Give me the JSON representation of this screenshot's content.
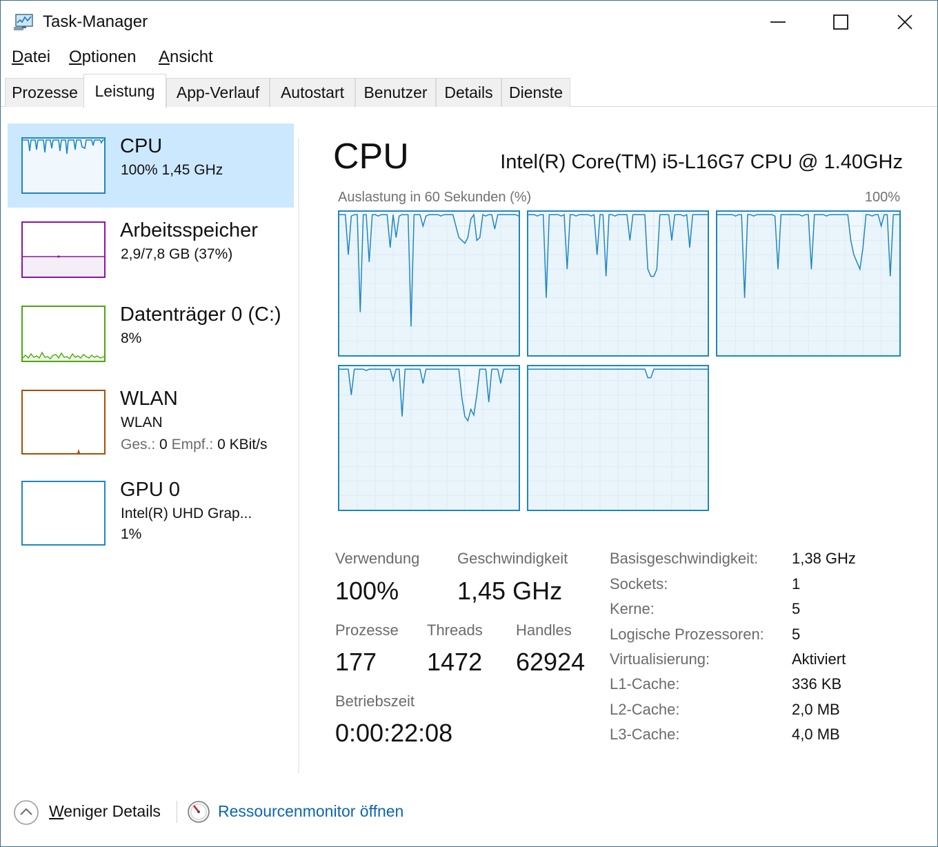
{
  "window": {
    "title": "Task-Manager",
    "app_icon": "task-manager-icon",
    "controls": [
      "minimize-icon",
      "maximize-icon",
      "close-icon"
    ]
  },
  "menu": {
    "items": [
      {
        "accel": "D",
        "rest": "atei"
      },
      {
        "accel": "O",
        "rest": "ptionen"
      },
      {
        "accel": "A",
        "rest": "nsicht"
      }
    ]
  },
  "tabs": [
    "Prozesse",
    "Leistung",
    "App-Verlauf",
    "Autostart",
    "Benutzer",
    "Details",
    "Dienste"
  ],
  "active_tab": "Leistung",
  "sidebar": {
    "items": [
      {
        "name": "CPU",
        "sub1": "100%  1,45 GHz",
        "color": "#1e86c2",
        "selected": true
      },
      {
        "name": "Arbeitsspeicher",
        "sub1": "2,9/7,8 GB (37%)",
        "color": "#8b12ae",
        "fill_fraction": 0.37
      },
      {
        "name": "Datenträger 0 (C:)",
        "sub1": "8%",
        "color": "#4da60c"
      },
      {
        "name": "WLAN",
        "sub1": "WLAN",
        "ges_label": "Ges.:",
        "ges_value": "0",
        "empf_label": "Empf.:",
        "empf_value": "0 KBit/s",
        "color": "#a74f01"
      },
      {
        "name": "GPU 0",
        "sub1": "Intel(R) UHD Grap...",
        "sub2": "1%",
        "color": "#1e86c2"
      }
    ]
  },
  "main": {
    "title": "CPU",
    "model": "Intel(R) Core(TM) i5-L16G7 CPU @ 1.40GHz",
    "graph_label": "Auslastung in 60 Sekunden (%)",
    "graph_max": "100%",
    "graph_color": "#1e86c2",
    "graph_fill": "#f1f8fd",
    "logical_processor_graphs": 5,
    "stats": {
      "verwendung_label": "Verwendung",
      "verwendung_value": "100%",
      "geschwindigkeit_label": "Geschwindigkeit",
      "geschwindigkeit_value": "1,45 GHz",
      "prozesse_label": "Prozesse",
      "prozesse_value": "177",
      "threads_label": "Threads",
      "threads_value": "1472",
      "handles_label": "Handles",
      "handles_value": "62924",
      "betriebszeit_label": "Betriebszeit",
      "betriebszeit_value": "0:00:22:08"
    },
    "info": [
      {
        "label": "Basisgeschwindigkeit:",
        "value": "1,38 GHz"
      },
      {
        "label": "Sockets:",
        "value": "1"
      },
      {
        "label": "Kerne:",
        "value": "5"
      },
      {
        "label": "Logische Prozessoren:",
        "value": "5"
      },
      {
        "label": "Virtualisierung:",
        "value": "Aktiviert"
      },
      {
        "label": "L1-Cache:",
        "value": "336 KB"
      },
      {
        "label": "L2-Cache:",
        "value": "2,0 MB"
      },
      {
        "label": "L3-Cache:",
        "value": "4,0 MB"
      }
    ]
  },
  "footer": {
    "less_accel": "W",
    "less_rest": "eniger Details",
    "resource_monitor": "Ressourcenmonitor öffnen",
    "less_icon": "chevron-up-circle-icon",
    "resource_icon": "resource-monitor-icon"
  }
}
